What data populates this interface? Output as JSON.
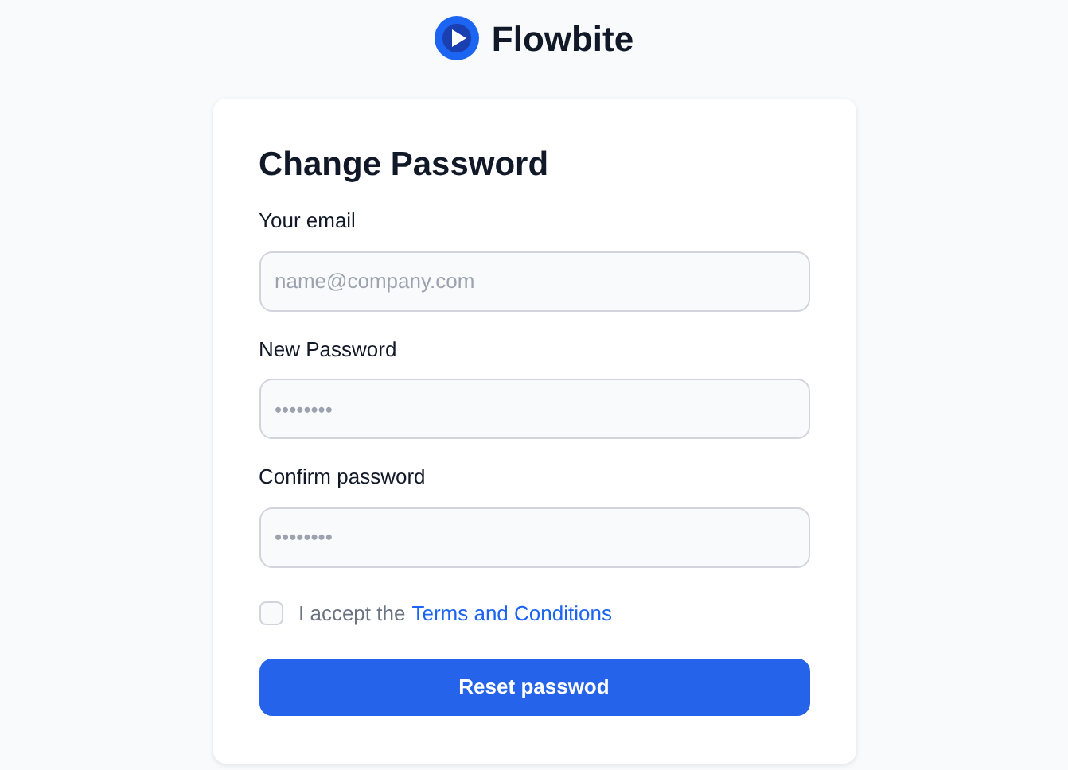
{
  "brand": {
    "name": "Flowbite"
  },
  "form": {
    "title": "Change Password",
    "fields": [
      {
        "label": "Your email",
        "placeholder": "name@company.com"
      },
      {
        "label": "New Password",
        "placeholder": "••••••••"
      },
      {
        "label": "Confirm password",
        "placeholder": "••••••••"
      }
    ],
    "terms": {
      "checked": false,
      "text": "I accept the",
      "link": "Terms and Conditions"
    },
    "submit": "Reset passwod"
  }
}
